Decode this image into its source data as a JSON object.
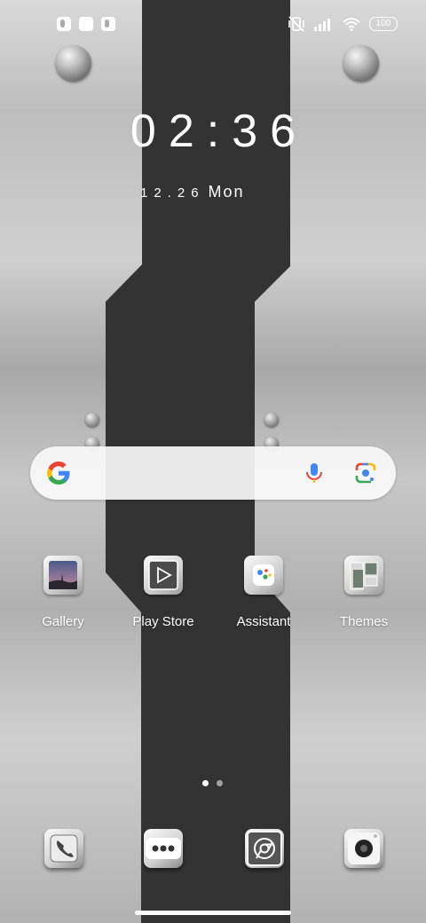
{
  "status_bar": {
    "left_icons": [
      "notification-app-icon",
      "notification-square-icon",
      "notification-app-icon"
    ],
    "right_icons": [
      "vibrate-off-icon",
      "signal-icon",
      "wifi-icon"
    ],
    "battery": "100"
  },
  "clock": {
    "time": "02:36",
    "date_numbers": "12.26",
    "weekday": "Mon"
  },
  "search": {
    "google_icon": "google-g-icon",
    "voice_icon": "mic-icon",
    "lens_icon": "google-lens-icon"
  },
  "apps": [
    {
      "label": "Gallery",
      "icon": "gallery-icon"
    },
    {
      "label": "Play Store",
      "icon": "play-store-icon"
    },
    {
      "label": "Assistant",
      "icon": "assistant-icon"
    },
    {
      "label": "Themes",
      "icon": "themes-icon"
    }
  ],
  "pager": {
    "pages": 2,
    "current": 1
  },
  "dock": [
    {
      "icon": "phone-icon"
    },
    {
      "icon": "messages-icon"
    },
    {
      "icon": "chrome-icon"
    },
    {
      "icon": "camera-icon"
    }
  ],
  "colors": {
    "band": "#333333",
    "metal": "#c0c0c0",
    "google_blue": "#4285F4",
    "google_red": "#EA4335",
    "google_yellow": "#FBBC05",
    "google_green": "#34A853"
  }
}
